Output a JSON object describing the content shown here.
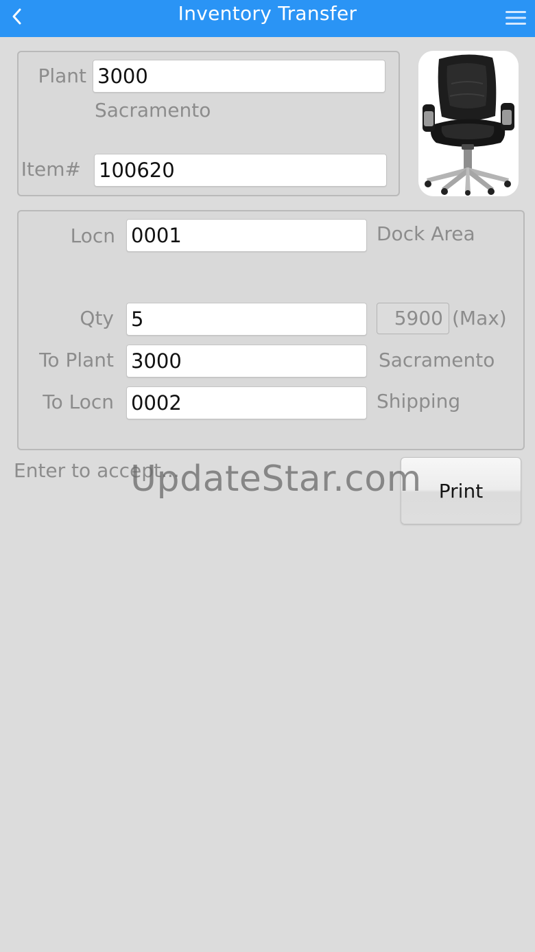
{
  "header": {
    "title": "Inventory Transfer",
    "back_icon": "chevron-left-icon",
    "menu_icon": "hamburger-menu-icon",
    "accent_color": "#2a94f5"
  },
  "item_panel": {
    "plant_label": "Plant",
    "plant_value": "3000",
    "plant_name": "Sacramento",
    "item_label": "Item#",
    "item_value": "100620",
    "image_subject": "black office chair"
  },
  "transfer_panel": {
    "locn_label": "Locn",
    "locn_value": "0001",
    "locn_name": "Dock Area",
    "qty_label": "Qty",
    "qty_value": "5",
    "qty_max_value": "5900",
    "qty_max_label": "(Max)",
    "to_plant_label": "To Plant",
    "to_plant_value": "3000",
    "to_plant_name": "Sacramento",
    "to_locn_label": "To Locn",
    "to_locn_value": "0002",
    "to_locn_name": "Shipping"
  },
  "footer": {
    "status_text": "Enter to accept...",
    "print_label": "Print"
  },
  "watermark": "UpdateStar.com"
}
